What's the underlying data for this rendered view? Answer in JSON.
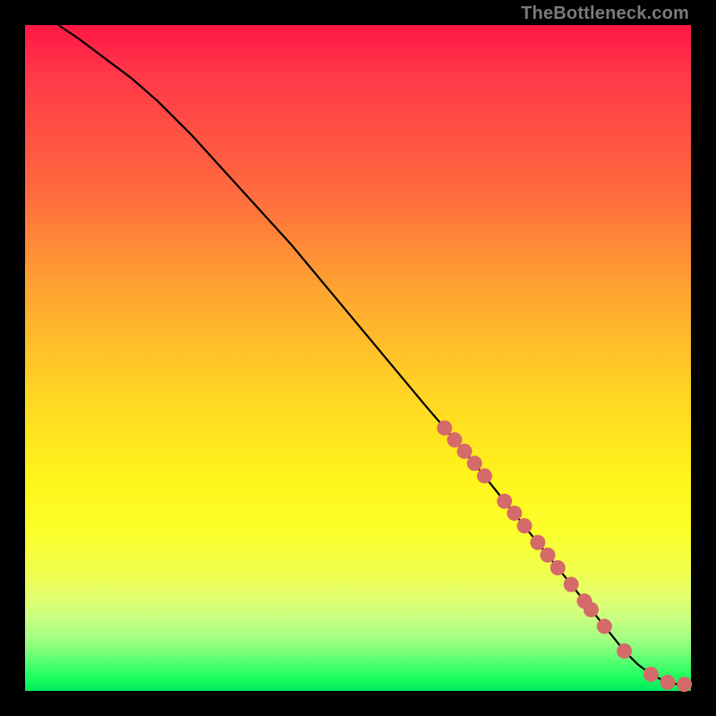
{
  "watermark": "TheBottleneck.com",
  "chart_data": {
    "type": "line",
    "title": "",
    "xlabel": "",
    "ylabel": "",
    "xlim": [
      0,
      100
    ],
    "ylim": [
      0,
      100
    ],
    "series": [
      {
        "name": "curve",
        "x": [
          5,
          8,
          12,
          16,
          20,
          25,
          30,
          35,
          40,
          45,
          50,
          55,
          60,
          63,
          66,
          68,
          70,
          72,
          74,
          76,
          78,
          80,
          82,
          84,
          86,
          88,
          90,
          92,
          94,
          96,
          98,
          100
        ],
        "y": [
          100,
          98,
          95,
          92,
          88.5,
          83.5,
          78,
          72.5,
          67,
          61,
          55,
          49,
          43,
          39.5,
          36,
          33.5,
          31,
          28.5,
          26,
          23.5,
          21,
          18.5,
          16,
          13.5,
          11,
          8.5,
          6,
          4,
          2.5,
          1.5,
          1,
          1
        ]
      }
    ],
    "markers": [
      {
        "x": 63,
        "y": 39.5
      },
      {
        "x": 64.5,
        "y": 37.7
      },
      {
        "x": 66,
        "y": 36
      },
      {
        "x": 67.5,
        "y": 34.2
      },
      {
        "x": 69,
        "y": 32.3
      },
      {
        "x": 72,
        "y": 28.5
      },
      {
        "x": 73.5,
        "y": 26.7
      },
      {
        "x": 75,
        "y": 24.8
      },
      {
        "x": 77,
        "y": 22.3
      },
      {
        "x": 78.5,
        "y": 20.4
      },
      {
        "x": 80,
        "y": 18.5
      },
      {
        "x": 82,
        "y": 16
      },
      {
        "x": 84,
        "y": 13.5
      },
      {
        "x": 85,
        "y": 12.2
      },
      {
        "x": 87,
        "y": 9.7
      },
      {
        "x": 90,
        "y": 6
      },
      {
        "x": 94,
        "y": 2.5
      },
      {
        "x": 96.5,
        "y": 1.3
      },
      {
        "x": 99,
        "y": 1
      }
    ],
    "colors": {
      "curve": "#000000",
      "marker": "#d56a6a",
      "gradient_top": "#ff1846",
      "gradient_mid": "#fff41b",
      "gradient_bottom": "#00e85e"
    }
  }
}
